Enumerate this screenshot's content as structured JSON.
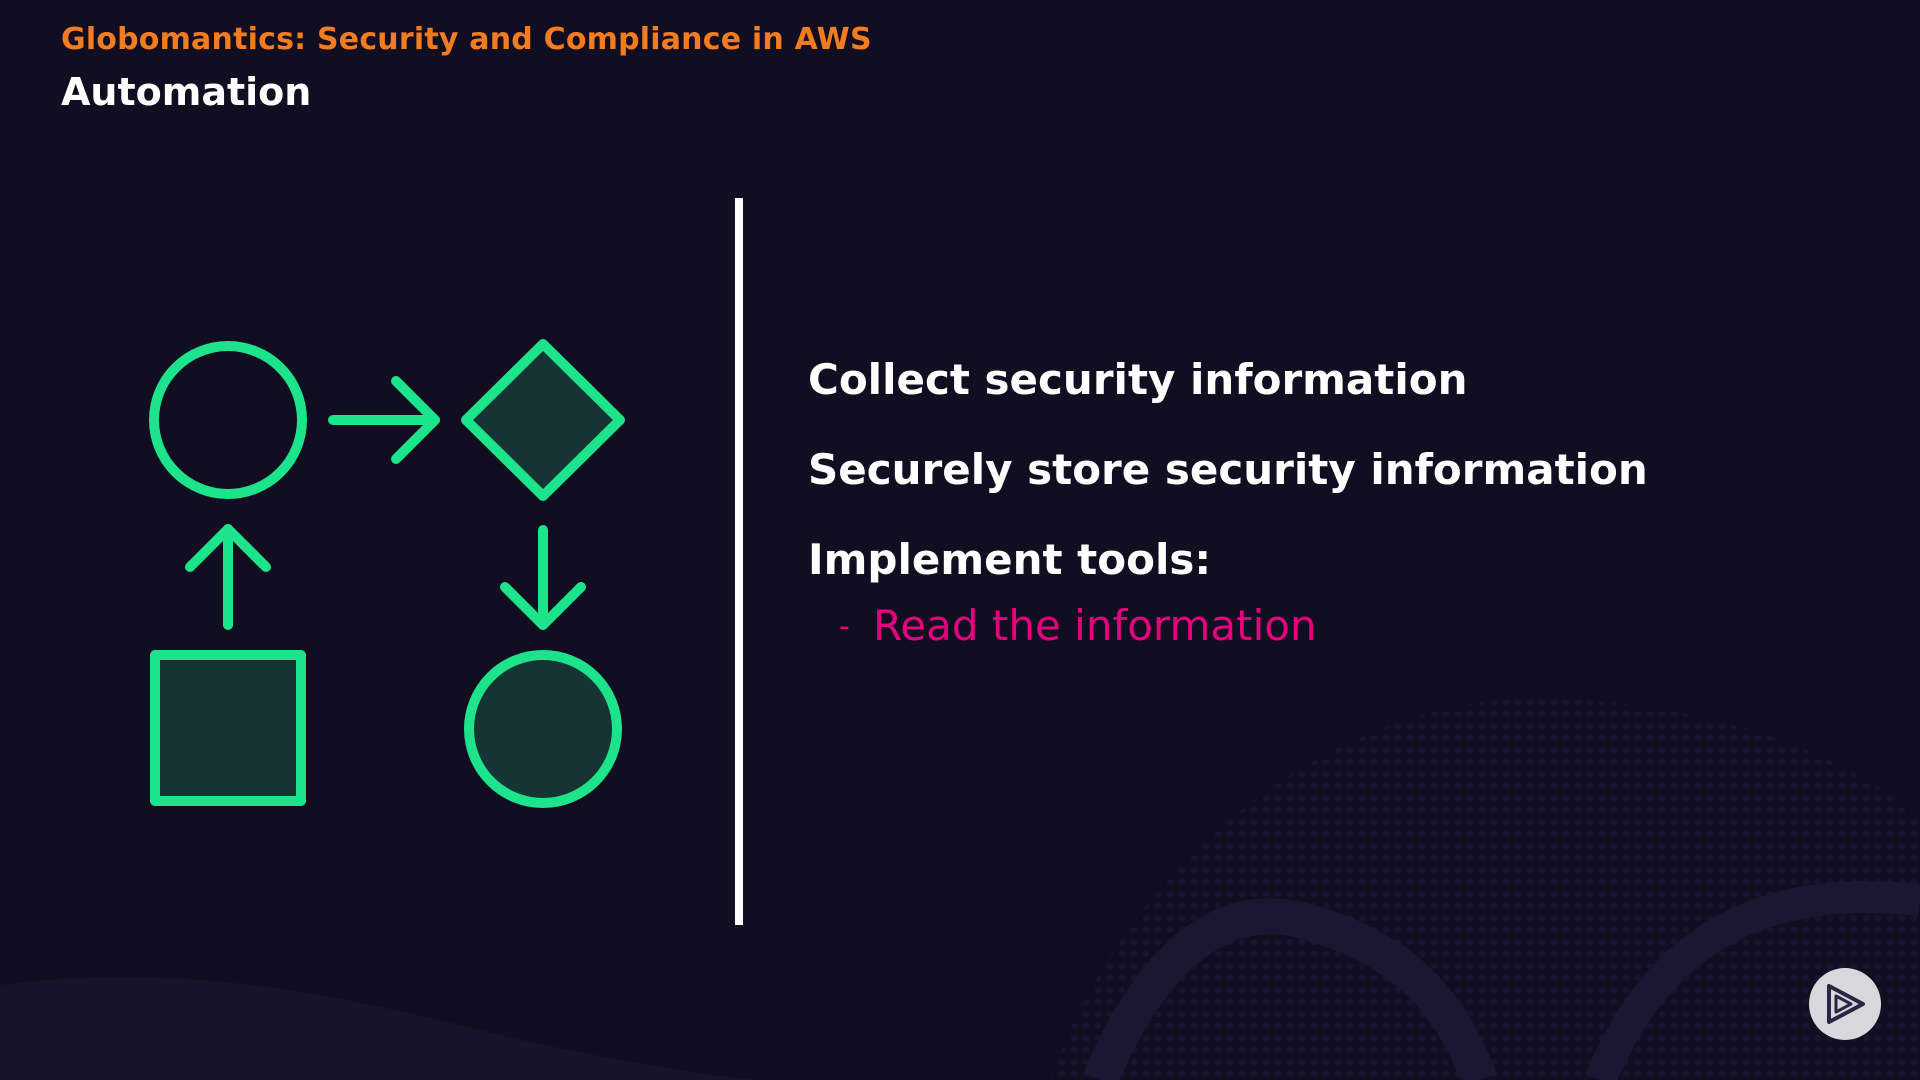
{
  "header": {
    "course_title": "Globomantics: Security and Compliance in AWS",
    "module_title": "Automation"
  },
  "content": {
    "bullets": [
      "Collect security information",
      "Securely store security information",
      "Implement tools:"
    ],
    "sub_bullet": {
      "dash": "-",
      "text": "Read the information"
    }
  },
  "diagram": {
    "shapes": [
      "circle-outline",
      "diamond-filled",
      "square-filled",
      "circle-filled"
    ],
    "arrows": [
      "right",
      "down",
      "up"
    ]
  },
  "colors": {
    "background": "#120e22",
    "course_title": "#f47c20",
    "module_title": "#ffffff",
    "diagram_stroke": "#1de38a",
    "diagram_fill": "#163434",
    "sub_bullet": "#e6007e",
    "divider": "#ffffff"
  },
  "icons": {
    "badge": "play-logo-icon"
  }
}
